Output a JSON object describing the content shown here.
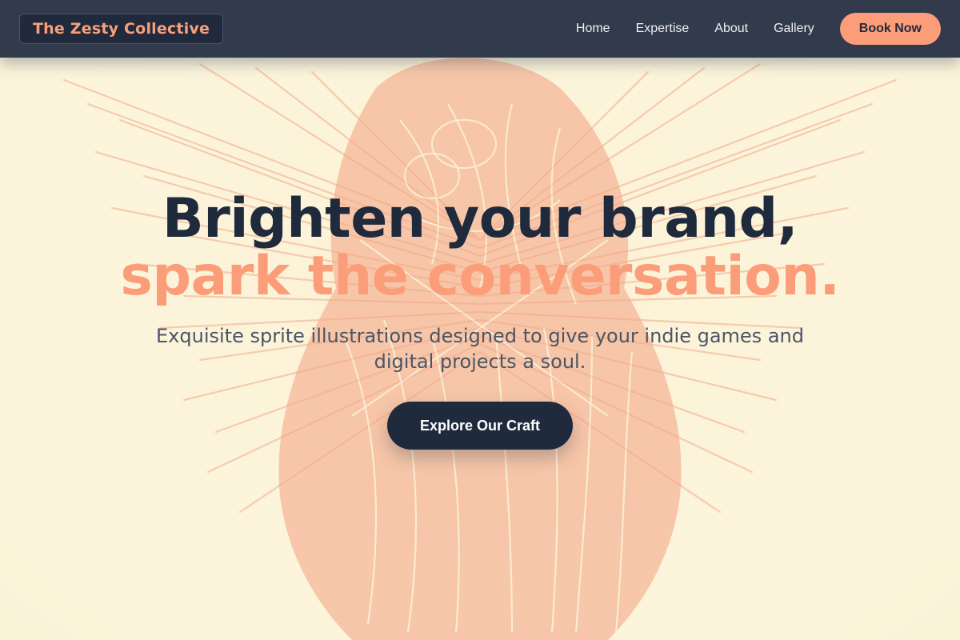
{
  "brand": {
    "name": "The Zesty Collective"
  },
  "nav": {
    "links": [
      "Home",
      "Expertise",
      "About",
      "Gallery"
    ],
    "cta_label": "Book Now"
  },
  "hero": {
    "headline_line1": "Brighten your brand,",
    "headline_line2": "spark the conversation.",
    "subtitle": "Exquisite sprite illustrations designed to give your indie games and digital projects a soul.",
    "cta_label": "Explore Our Craft"
  },
  "colors": {
    "navbar": "#323b4c",
    "accent": "#fb9d78",
    "dark": "#1f2a3d",
    "background": "#fcf5dc",
    "illustration": "#f3a586"
  },
  "background_image": {
    "description_icon": "angel-engraving-illustration"
  }
}
